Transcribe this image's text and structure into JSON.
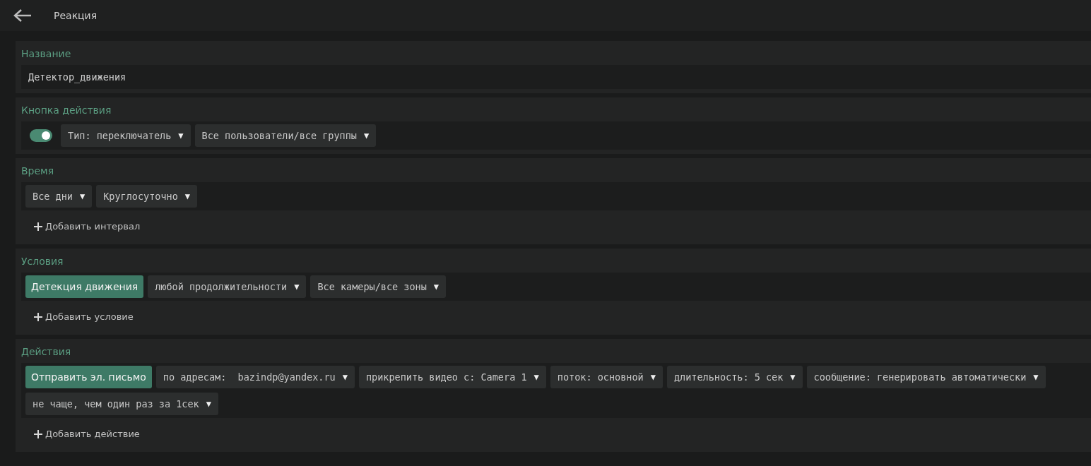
{
  "header": {
    "title": "Реакция"
  },
  "sections": [
    {
      "title": "Название",
      "field": {
        "value": "Детектор_движения"
      }
    },
    {
      "title": "Кнопка действия",
      "toggle": {
        "on": true
      },
      "items": [
        {
          "kind": "dropdown",
          "label": "Тип: переключатель",
          "arrow": "▼"
        },
        {
          "kind": "dropdown",
          "label": "Все пользователи/все группы",
          "arrow": "▼"
        }
      ]
    },
    {
      "title": "Время",
      "items": [
        {
          "kind": "dropdown",
          "label": "Все дни",
          "arrow": "▼"
        },
        {
          "kind": "dropdown",
          "label": "Круглосуточно",
          "arrow": "▼"
        }
      ],
      "add_link": "Добавить интервал"
    },
    {
      "title": "Условия",
      "items": [
        {
          "kind": "button",
          "label": "Детекция движения"
        },
        {
          "kind": "dropdown",
          "label": "любой продолжительности",
          "arrow": "▼"
        },
        {
          "kind": "dropdown",
          "label": "Все камеры/все зоны",
          "arrow": "▼"
        }
      ],
      "add_link": "Добавить условие"
    },
    {
      "title": "Действия",
      "items": [
        {
          "kind": "button",
          "label": "Отправить эл. письмо"
        },
        {
          "kind": "dropdown",
          "label": "по адресам:  bazindp@yandex.ru",
          "arrow": "▼"
        },
        {
          "kind": "dropdown",
          "label": "прикрепить видео с: Camera 1",
          "arrow": "▼"
        },
        {
          "kind": "dropdown",
          "label": "поток: основной",
          "arrow": "▼"
        },
        {
          "kind": "dropdown",
          "label": "длительность: 5 сек",
          "arrow": "▼"
        },
        {
          "kind": "dropdown",
          "label": "сообщение: генерировать автоматически",
          "arrow": "▼"
        },
        {
          "kind": "dropdown",
          "label": "не чаще, чем один раз за 1сек",
          "arrow": "▼"
        }
      ],
      "add_link": "Добавить действие"
    }
  ]
}
